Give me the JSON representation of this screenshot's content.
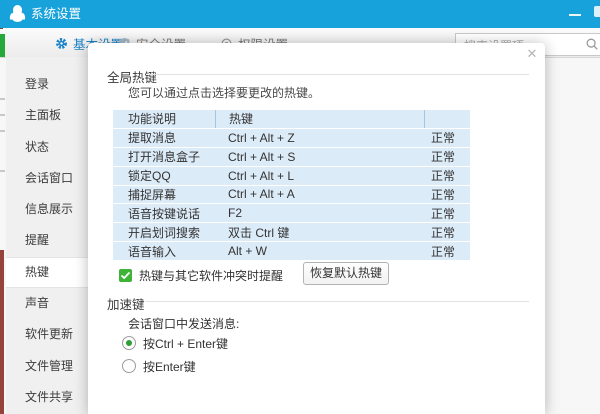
{
  "titlebar": {
    "title": "系统设置"
  },
  "tabs": [
    {
      "label": "基本设置",
      "active": true
    },
    {
      "label": "安全设置",
      "active": false
    },
    {
      "label": "权限设置",
      "active": false
    }
  ],
  "search": {
    "placeholder": "搜索设置项"
  },
  "sidebar": {
    "selected": "热键",
    "items": [
      "登录",
      "主面板",
      "状态",
      "会话窗口",
      "信息展示",
      "提醒",
      "热键",
      "声音",
      "软件更新",
      "文件管理",
      "文件共享"
    ]
  },
  "dialog": {
    "close_glyph": "✕",
    "global": {
      "title": "全局热键",
      "hint": "您可以通过点击选择要更改的热键。",
      "table": {
        "headers": {
          "name": "功能说明",
          "hotkey": "热键"
        },
        "rows": [
          {
            "name": "提取消息",
            "hotkey": "Ctrl + Alt + Z",
            "status": "正常"
          },
          {
            "name": "打开消息盒子",
            "hotkey": "Ctrl + Alt + S",
            "status": "正常"
          },
          {
            "name": "锁定QQ",
            "hotkey": "Ctrl + Alt + L",
            "status": "正常"
          },
          {
            "name": "捕捉屏幕",
            "hotkey": "Ctrl + Alt + A",
            "status": "正常"
          },
          {
            "name": "语音按键说话",
            "hotkey": "F2",
            "status": "正常"
          },
          {
            "name": "开启划词搜索",
            "hotkey": "双击 Ctrl 键",
            "status": "正常"
          },
          {
            "name": "语音输入",
            "hotkey": "Alt + W",
            "status": "正常"
          }
        ]
      },
      "conflict_reminder": {
        "label": "热键与其它软件冲突时提醒",
        "checked": true
      },
      "restore_button": "恢复默认热键"
    },
    "accelerator": {
      "title": "加速键",
      "subtitle": "会话窗口中发送消息:",
      "options": [
        {
          "label": "按Ctrl + Enter键",
          "selected": true
        },
        {
          "label": "按Enter键",
          "selected": false
        }
      ]
    }
  },
  "accents": {
    "titlebar_blue": "#18a2dc",
    "active_tab_blue": "#1b82c6",
    "table_background": "#dcebf8",
    "checkbox_green": "#3db438",
    "radio_green": "#2f9e36",
    "edge_fragment_green": "#27a83b",
    "edge_fragment_red": "#96443a"
  }
}
